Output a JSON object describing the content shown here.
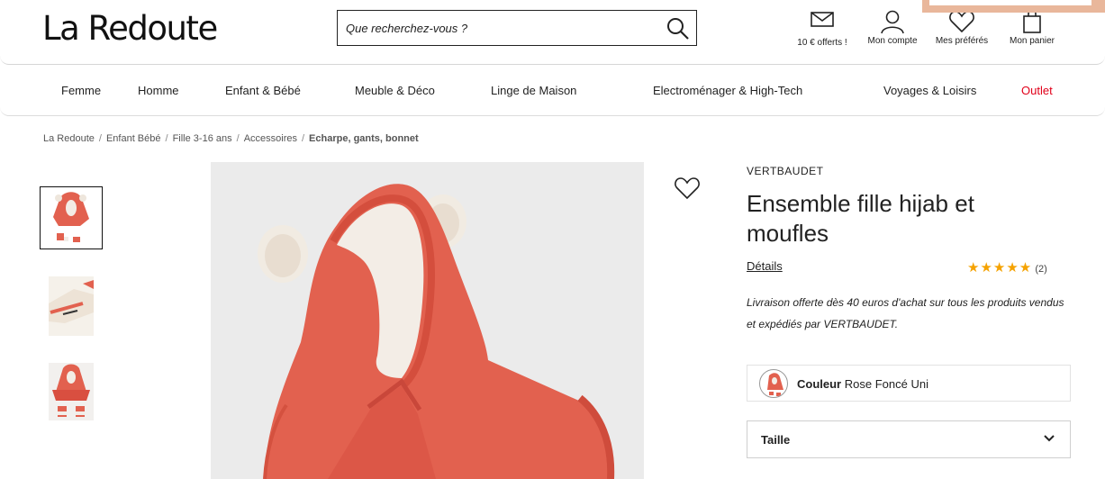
{
  "header": {
    "logo": "La Redoute",
    "search_placeholder": "Que recherchez-vous ?",
    "items": [
      {
        "label": "10 € offerts !",
        "icon": "envelope-icon"
      },
      {
        "label": "Mon compte",
        "icon": "user-icon"
      },
      {
        "label": "Mes préférés",
        "icon": "heart-icon"
      },
      {
        "label": "Mon panier",
        "icon": "shopping-bag-icon"
      }
    ]
  },
  "nav": {
    "items": [
      "Femme",
      "Homme",
      "Enfant & Bébé",
      "Meuble & Déco",
      "Linge de Maison",
      "Electroménager & High-Tech",
      "Voyages & Loisirs",
      "Outlet"
    ]
  },
  "breadcrumb": [
    "La Redoute",
    "Enfant Bébé",
    "Fille 3-16 ans",
    "Accessoires",
    "Echarpe, gants, bonnet"
  ],
  "product": {
    "brand": "VERTBAUDET",
    "title": "Ensemble fille hijab et moufles",
    "details_link": "Détails",
    "stars": "★★★★★",
    "rating_count": "(2)",
    "shipping_line1": "Livraison offerte dès 40 euros d'achat sur tous les produits vendus",
    "shipping_line2": "et expédiés par VERTBAUDET.",
    "color_label": "Couleur",
    "color_value": "Rose Foncé Uni",
    "size_label": "Taille"
  },
  "colors": {
    "accent_red": "#e1001a",
    "product_coral": "#e2614f",
    "star": "#f5a200"
  }
}
